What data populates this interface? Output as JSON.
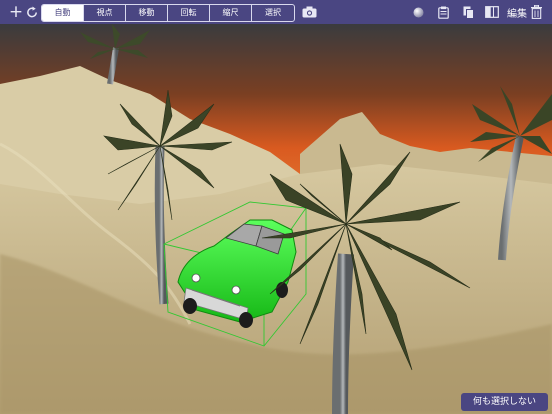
{
  "toolbar": {
    "add_icon": "plus-icon",
    "undo_icon": "rotate-icon",
    "modes": [
      "自動",
      "視点",
      "移動",
      "回転",
      "縮尺",
      "選択"
    ],
    "active_mode": "自動",
    "camera_icon": "camera-icon",
    "right_icons": [
      "sphere-icon",
      "clipboard-icon",
      "copy-icon",
      "split-view-icon"
    ],
    "edit_label": "編集",
    "trash_icon": "trash-icon"
  },
  "scene": {
    "description_icon": "3d-viewport",
    "selected_object_color": "#22dd22"
  },
  "deselect_button": {
    "label": "何も選択しない"
  },
  "colors": {
    "toolbar_bg": "#4a4682",
    "accent": "#ffffff"
  }
}
